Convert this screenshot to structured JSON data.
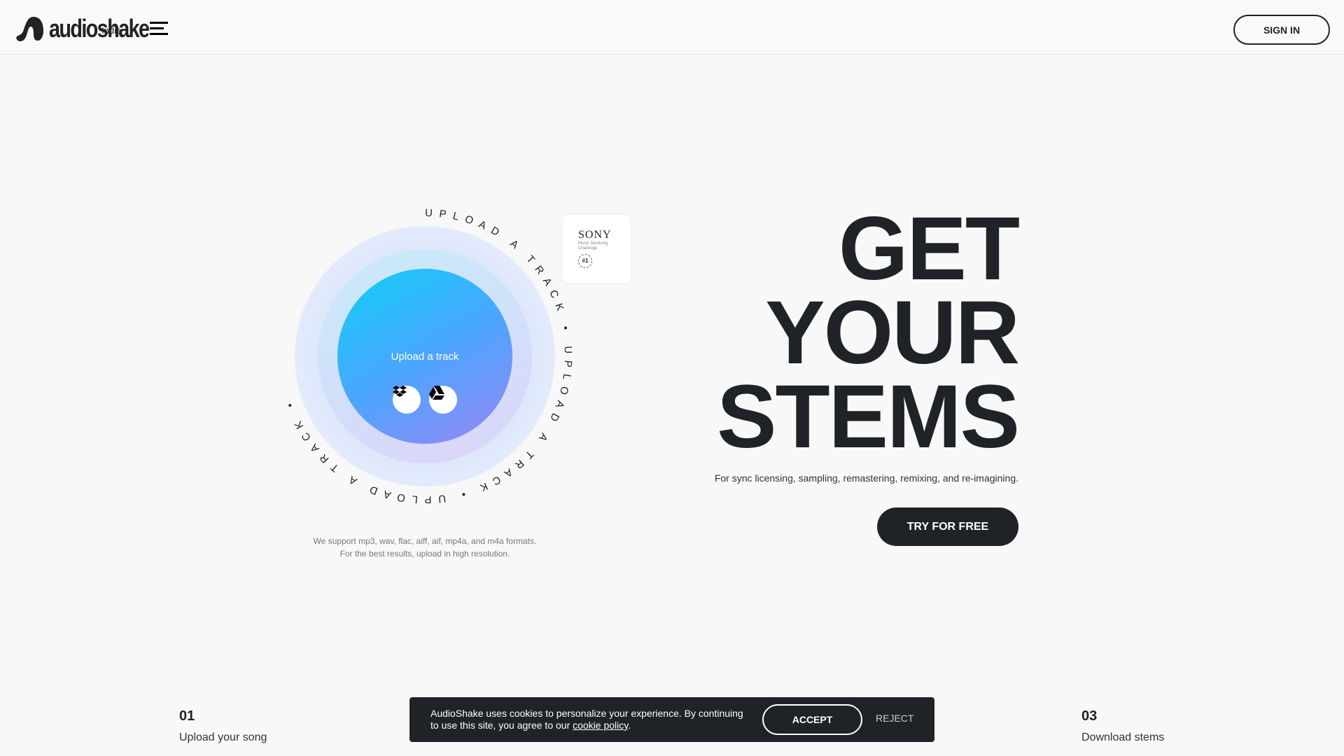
{
  "header": {
    "logo_text": "audioshake",
    "logo_sub": "Indie",
    "menu_icon": "hamburger-icon",
    "sign_in": "SIGN IN"
  },
  "uploader": {
    "ring_text": "UPLOAD A TRACK • UPLOAD A TRACK • UPLOAD A TRACK • ",
    "label": "Upload a track",
    "dropbox_icon": "dropbox-icon",
    "drive_icon": "google-drive-icon",
    "formats_line1": "We support mp3, wav, flac, aiff, aif, mp4a, and m4a formats.",
    "formats_line2": "For the best results, upload in high resolution.",
    "colors": {
      "gradient_start": "#0fcff7",
      "gradient_mid": "#4aa6ff",
      "gradient_end": "#9a86f5"
    }
  },
  "badge": {
    "brand": "SONY",
    "line1": "Music Demixing",
    "line2": "Challenge",
    "rank": "#1"
  },
  "hero": {
    "line1": "GET",
    "line2": "YOUR",
    "line3": "STEMS",
    "subtitle": "For sync licensing, sampling, remastering, remixing, and re-imagining.",
    "cta": "TRY FOR FREE"
  },
  "steps": [
    {
      "num": "01",
      "label": "Upload your song"
    },
    {
      "num": "03",
      "label": "Download stems"
    }
  ],
  "cookie": {
    "text": "AudioShake uses cookies to personalize your experience. By continuing to use this site, you agree to our ",
    "link": "cookie policy",
    "end": ".",
    "accept": "ACCEPT",
    "reject": "REJECT"
  }
}
